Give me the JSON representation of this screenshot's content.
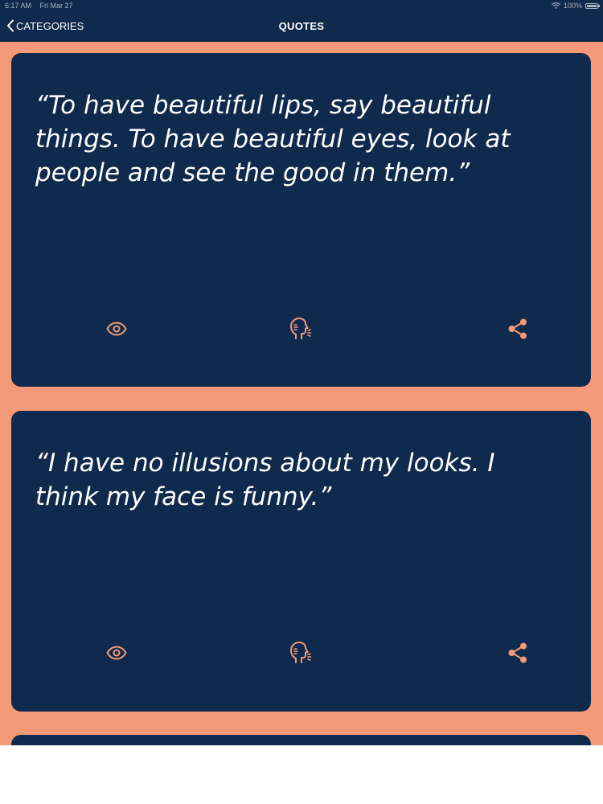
{
  "status": {
    "time": "6:17 AM",
    "date": "Fri Mar 27",
    "battery": "100%"
  },
  "nav": {
    "back_label": "CATEGORIES",
    "title": "QUOTES"
  },
  "quotes": [
    {
      "text": "“To have beautiful lips, say beautiful things. To have beautiful eyes, look at people and see the good in them.”",
      "actions": [
        "eye-icon",
        "speak-icon",
        "share-icon"
      ]
    },
    {
      "text": "“I have no illusions about my looks. I think my face is funny.”",
      "actions": [
        "eye-icon",
        "speak-icon",
        "share-icon"
      ]
    }
  ],
  "colors": {
    "background": "#f49a78",
    "card": "#0f2a4c",
    "accent": "#f49a78",
    "text": "#ffffff"
  }
}
